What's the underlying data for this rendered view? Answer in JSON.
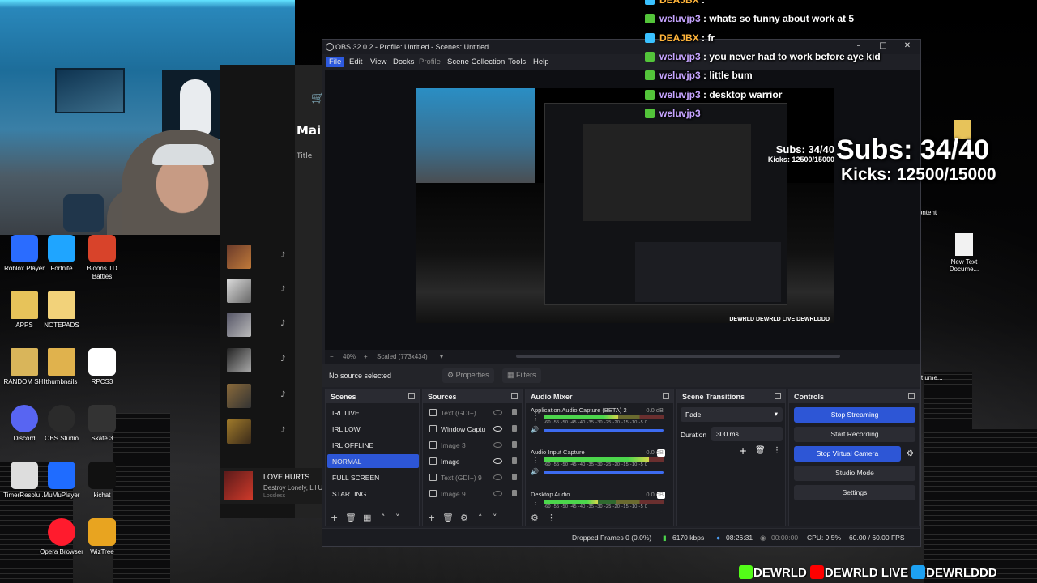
{
  "desktop": {
    "icons": [
      {
        "label": "Roblox Player",
        "icon": "roblox-icon",
        "color": "#2a6cff"
      },
      {
        "label": "Fortnite",
        "icon": "fortnite-icon",
        "color": "#1fa5ff"
      },
      {
        "label": "Bloons TD Battles",
        "icon": "bloons-icon",
        "color": "#d8432a"
      },
      {
        "label": "APPS",
        "icon": "folder-icon",
        "color": "#e7c35a"
      },
      {
        "label": "NOTEPADS",
        "icon": "folder-icon",
        "color": "#f2d27a"
      },
      {
        "label": "RANDOM SHI",
        "icon": "folder-icon",
        "color": "#d9b55a"
      },
      {
        "label": "thumbnails",
        "icon": "folder-icon",
        "color": "#e0b24d"
      },
      {
        "label": "RPCS3",
        "icon": "file-icon",
        "color": "#ffffff"
      },
      {
        "label": "Discord",
        "icon": "discord-icon",
        "color": "#5865f2"
      },
      {
        "label": "OBS Studio",
        "icon": "obs-icon",
        "color": "#2b2b2b"
      },
      {
        "label": "Skate 3",
        "icon": "skate-icon",
        "color": "#333333"
      },
      {
        "label": "TimerResolu...",
        "icon": "clock-icon",
        "color": "#dddddd"
      },
      {
        "label": "MuMuPlayer",
        "icon": "mumu-icon",
        "color": "#1f6cff"
      },
      {
        "label": "kichat",
        "icon": "kick-icon",
        "color": "#111111"
      },
      {
        "label": "Opera Browser",
        "icon": "opera-icon",
        "color": "#ff1b2d"
      },
      {
        "label": "WizTree",
        "icon": "wiztree-icon",
        "color": "#e8a420"
      }
    ],
    "right_icons": [
      {
        "label": "New Text Docume...",
        "icon": "file-icon"
      },
      {
        "label": "ontent",
        "icon": "file-icon"
      },
      {
        "label": "Text ume...",
        "icon": "file-icon"
      }
    ]
  },
  "music_app": {
    "header_text": "Mai",
    "column_title": "Title",
    "now_playing": {
      "title": "LOVE HURTS",
      "artist": "Destroy Lonely, Lil U",
      "quality": "Lossless"
    }
  },
  "obs": {
    "window_title": "OBS 32.0.2 - Profile: Untitled - Scenes: Untitled",
    "menu": [
      "File",
      "Edit",
      "View",
      "Docks",
      "Profile",
      "Scene Collection",
      "Tools",
      "Help"
    ],
    "zoom": {
      "minus": "−",
      "percent": "40%",
      "plus": "+",
      "scaled": "Scaled (773x434)"
    },
    "source_bar": {
      "no_source": "No source selected",
      "properties": "Properties",
      "filters": "Filters"
    },
    "preview_overlay": {
      "subs": "Subs: 34/40",
      "kicks": "Kicks: 12500/15000",
      "tags": "DEWRLD  DEWRLD LIVE  DEWRLDDD"
    },
    "scenes": {
      "title": "Scenes",
      "items": [
        "IRL LIVE",
        "IRL LOW",
        "IRL OFFLINE",
        "NORMAL",
        "FULL SCREEN",
        "STARTING"
      ],
      "selected": "NORMAL"
    },
    "sources": {
      "title": "Sources",
      "items": [
        {
          "name": "Text (GDI+)",
          "dim": true
        },
        {
          "name": "Window Captu",
          "dim": false
        },
        {
          "name": "Image 3",
          "dim": true
        },
        {
          "name": "Image",
          "dim": false
        },
        {
          "name": "Text (GDI+) 9",
          "dim": true
        },
        {
          "name": "Image 9",
          "dim": true
        }
      ]
    },
    "audio_mixer": {
      "title": "Audio Mixer",
      "scale": "-60 -55 -50 -45 -40 -35 -30 -25 -20 -15 -10 -5 0",
      "tracks": [
        {
          "name": "Application Audio Capture (BETA) 2",
          "db": "0.0 dB",
          "level": 0.62
        },
        {
          "name": "Audio Input Capture",
          "db": "0.0 dB",
          "level": 0.88
        },
        {
          "name": "Desktop Audio",
          "db": "0.0 dB",
          "level": 0.45
        }
      ]
    },
    "scene_transitions": {
      "title": "Scene Transitions",
      "transition": "Fade",
      "duration_label": "Duration",
      "duration": "300 ms"
    },
    "controls": {
      "title": "Controls",
      "buttons": [
        {
          "label": "Stop Streaming",
          "active": true
        },
        {
          "label": "Start Recording",
          "active": false
        },
        {
          "label": "Stop Virtual Camera",
          "active": true
        },
        {
          "label": "Studio Mode",
          "active": false
        },
        {
          "label": "Settings",
          "active": false
        }
      ]
    },
    "status": {
      "dropped": "Dropped Frames 0 (0.0%)",
      "bitrate": "6170 kbps",
      "stream_time": "08:26:31",
      "rec_time": "00:00:00",
      "cpu": "CPU: 9.5%",
      "fps": "60.00 / 60.00 FPS"
    }
  },
  "chat": {
    "lines": [
      {
        "user": "DEAJBX",
        "msg": " : ",
        "user_color": "orange"
      },
      {
        "user": "weluvjp3",
        "msg": " : whats so funny about work at 5",
        "user_color": "purple"
      },
      {
        "user": "DEAJBX",
        "msg": " : fr",
        "user_color": "orange"
      },
      {
        "user": "weluvjp3",
        "msg": " : you never had to work before aye kid",
        "user_color": "purple"
      },
      {
        "user": "weluvjp3",
        "msg": " : little bum",
        "user_color": "purple"
      },
      {
        "user": "weluvjp3",
        "msg": " : desktop warrior",
        "user_color": "purple"
      },
      {
        "user": "weluvjp3",
        "msg": "",
        "user_color": "purple"
      }
    ]
  },
  "stream_overlay": {
    "subs": "Subs: 34/40",
    "kicks": "Kicks: 12500/15000",
    "socials": [
      {
        "platform": "kick",
        "handle": "DEWRLD",
        "color": "#53fc18"
      },
      {
        "platform": "youtube",
        "handle": "DEWRLD LIVE",
        "color": "#ff0000"
      },
      {
        "platform": "twitter",
        "handle": "DEWRLDDD",
        "color": "#1da1f2"
      }
    ]
  }
}
